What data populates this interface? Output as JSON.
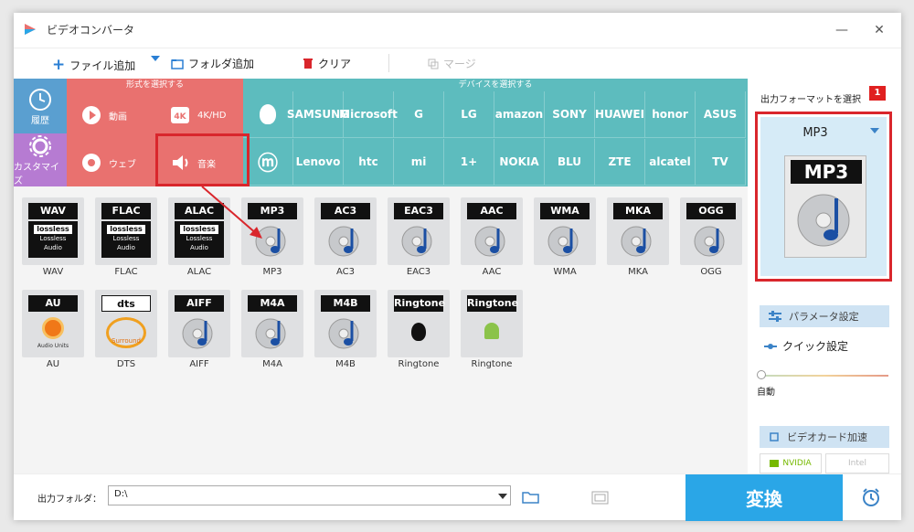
{
  "window": {
    "title": "ビデオコンバータ",
    "minimize": "—",
    "close": "✕"
  },
  "toolbar": {
    "add_file": "ファイル追加",
    "add_folder": "フォルダ追加",
    "clear": "クリア",
    "merge": "マージ"
  },
  "tabs": {
    "history": "履歴",
    "customize": "カスタマイズ",
    "format_header": "形式を選択する",
    "device_header": "デバイスを選択する"
  },
  "format_categories": [
    {
      "label": "動画",
      "icon": "play-icon"
    },
    {
      "label": "4K/HD",
      "icon": "4k-icon"
    },
    {
      "label": "ウェブ",
      "icon": "chrome-icon"
    },
    {
      "label": "音楽",
      "icon": "speaker-icon"
    }
  ],
  "devices_row1": [
    "",
    "SAMSUNG",
    "Microsoft",
    "G",
    "LG",
    "amazon",
    "SONY",
    "HUAWEI",
    "honor",
    "ASUS"
  ],
  "devices_row2": [
    "",
    "Lenovo",
    "htc",
    "mi",
    "1+",
    "NOKIA",
    "BLU",
    "ZTE",
    "alcatel",
    "TV"
  ],
  "audio_formats_row1": [
    {
      "badge": "WAV",
      "label": "WAV",
      "type": "lossless"
    },
    {
      "badge": "FLAC",
      "label": "FLAC",
      "type": "lossless"
    },
    {
      "badge": "ALAC",
      "label": "ALAC",
      "type": "lossless"
    },
    {
      "badge": "MP3",
      "label": "MP3",
      "type": "disc"
    },
    {
      "badge": "AC3",
      "label": "AC3",
      "type": "disc"
    },
    {
      "badge": "EAC3",
      "label": "EAC3",
      "type": "disc"
    },
    {
      "badge": "AAC",
      "label": "AAC",
      "type": "disc"
    },
    {
      "badge": "WMA",
      "label": "WMA",
      "type": "disc"
    },
    {
      "badge": "MKA",
      "label": "MKA",
      "type": "disc"
    },
    {
      "badge": "OGG",
      "label": "OGG",
      "type": "disc"
    }
  ],
  "audio_formats_row2": [
    {
      "badge": "AU",
      "label": "AU",
      "type": "au"
    },
    {
      "badge": "dts",
      "label": "DTS",
      "type": "dts"
    },
    {
      "badge": "AIFF",
      "label": "AIFF",
      "type": "disc"
    },
    {
      "badge": "M4A",
      "label": "M4A",
      "type": "disc"
    },
    {
      "badge": "M4B",
      "label": "M4B",
      "type": "disc"
    },
    {
      "badge": "Ringtone",
      "label": "Ringtone",
      "type": "apple"
    },
    {
      "badge": "Ringtone",
      "label": "Ringtone",
      "type": "android"
    }
  ],
  "lossless_text": {
    "brand": "lossless",
    "line1": "Lossless",
    "line2": "Audio"
  },
  "au_text": "Audio Units",
  "dts_text": "Surround",
  "output_panel": {
    "title": "出力フォーマットを選択",
    "step": "1",
    "selected": "MP3",
    "badge": "MP3",
    "params": "パラメータ設定",
    "quick": "クイック設定",
    "auto": "自動",
    "gpu": "ビデオカード加速",
    "nvidia": "NVIDIA",
    "intel": "Intel"
  },
  "bottom": {
    "output_label": "出力フォルダ：",
    "output_path": "D:\\",
    "convert": "変換"
  },
  "colors": {
    "format_bg": "#e9716f",
    "device_bg": "#5dbcbe",
    "history_bg": "#5a9fd0",
    "custom_bg": "#b67bd2",
    "convert_bg": "#2aa6e7",
    "highlight": "#d9262c"
  }
}
